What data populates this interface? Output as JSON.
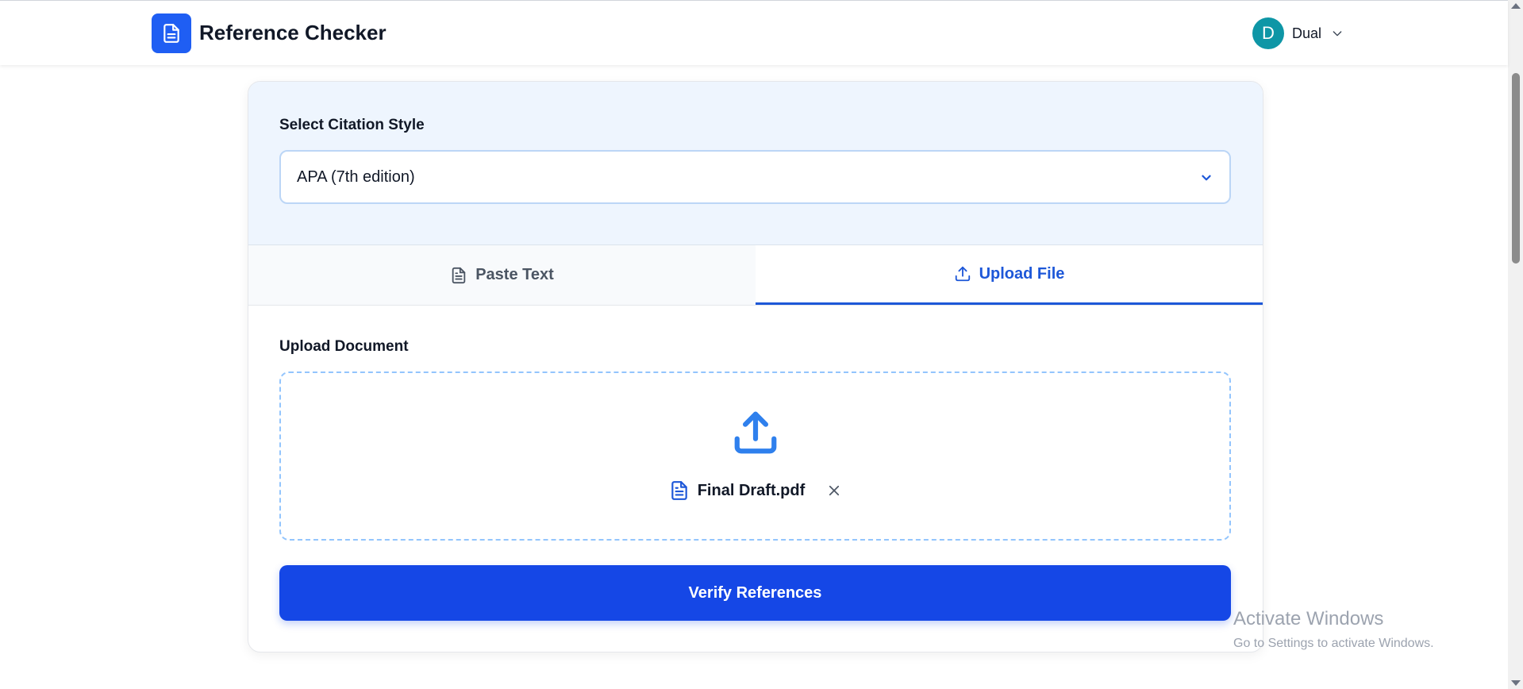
{
  "header": {
    "app_title": "Reference Checker",
    "logo_icon": "document-icon",
    "user": {
      "avatar_initial": "D",
      "name": "Dual",
      "avatar_color": "#0e96a6"
    }
  },
  "citation": {
    "label": "Select Citation Style",
    "selected": "APA (7th edition)"
  },
  "tabs": [
    {
      "label": "Paste Text",
      "icon": "document-text-icon",
      "active": false
    },
    {
      "label": "Upload File",
      "icon": "upload-icon",
      "active": true
    }
  ],
  "upload": {
    "label": "Upload Document",
    "file_name": "Final Draft.pdf"
  },
  "verify_button": "Verify References",
  "watermark": {
    "title": "Activate Windows",
    "subtitle": "Go to Settings to activate Windows."
  },
  "colors": {
    "brand_blue": "#1f5ef3",
    "active_tab": "#1d57d8",
    "primary_button": "#1547e6",
    "panel_bg": "#eef5fe",
    "dropzone_border": "#93c5fd"
  }
}
